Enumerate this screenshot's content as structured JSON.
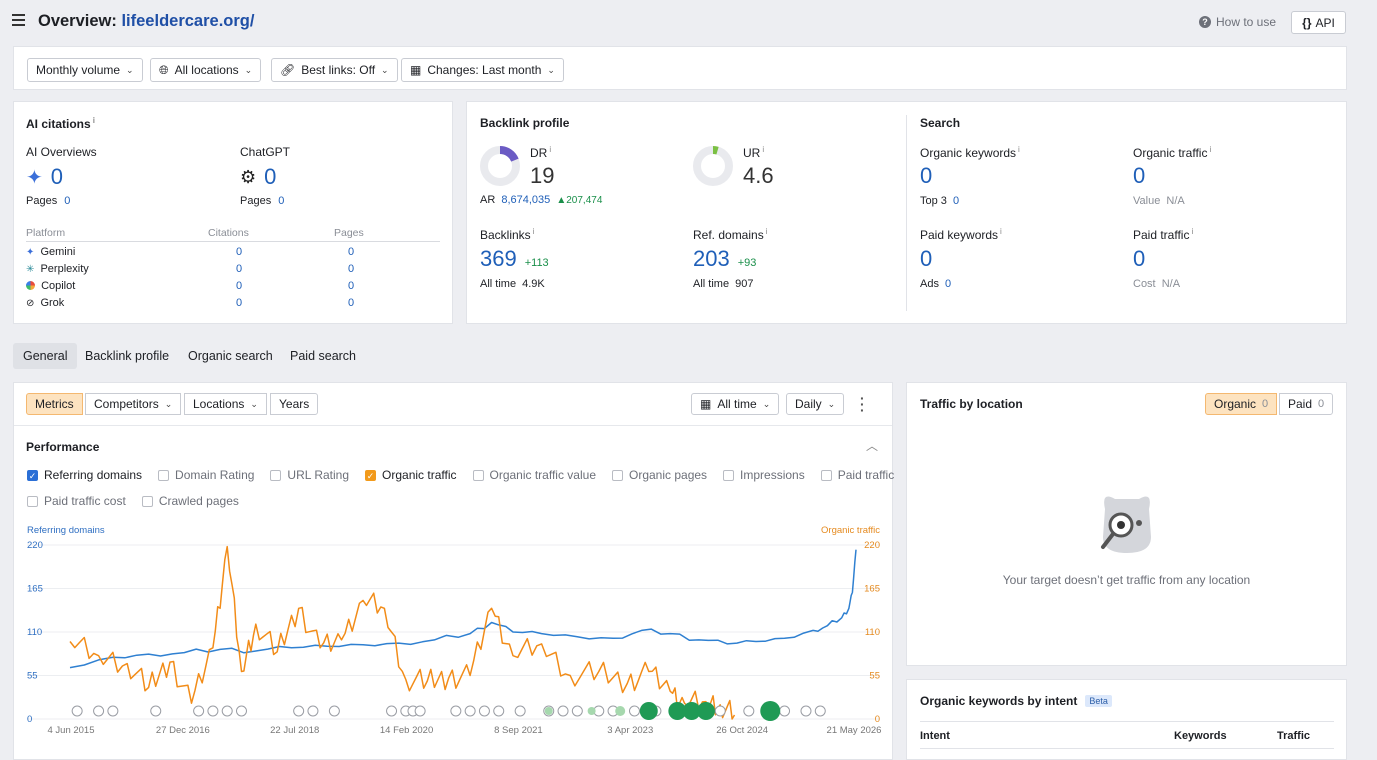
{
  "header": {
    "title_prefix": "Overview:",
    "domain": "lifeeldercare.org/",
    "how_to_use": "How to use",
    "api": "API"
  },
  "filters": {
    "volume": "Monthly volume",
    "locations": "All locations",
    "best_links": "Best links: Off",
    "changes": "Changes: Last month"
  },
  "ai": {
    "title": "AI citations",
    "overviews_label": "AI Overviews",
    "overviews_value": "0",
    "overviews_pages_label": "Pages",
    "overviews_pages_value": "0",
    "chatgpt_label": "ChatGPT",
    "chatgpt_value": "0",
    "chatgpt_pages_label": "Pages",
    "chatgpt_pages_value": "0",
    "table_headers": [
      "Platform",
      "Citations",
      "Pages"
    ],
    "platforms": [
      {
        "name": "Gemini",
        "citations": "0",
        "pages": "0"
      },
      {
        "name": "Perplexity",
        "citations": "0",
        "pages": "0"
      },
      {
        "name": "Copilot",
        "citations": "0",
        "pages": "0"
      },
      {
        "name": "Grok",
        "citations": "0",
        "pages": "0"
      }
    ]
  },
  "backlink": {
    "title": "Backlink profile",
    "dr_label": "DR",
    "dr_value": "19",
    "ur_label": "UR",
    "ur_value": "4.6",
    "ar_label": "AR",
    "ar_value": "8,674,035",
    "ar_change": "▲207,474",
    "backlinks_label": "Backlinks",
    "backlinks_value": "369",
    "backlinks_change": "+113",
    "backlinks_alltime_label": "All time",
    "backlinks_alltime_value": "4.9K",
    "refdomains_label": "Ref. domains",
    "refdomains_value": "203",
    "refdomains_change": "+93",
    "refdomains_alltime_label": "All time",
    "refdomains_alltime_value": "907"
  },
  "search": {
    "title": "Search",
    "organic_keywords_label": "Organic keywords",
    "organic_keywords_value": "0",
    "top3_label": "Top 3",
    "top3_value": "0",
    "organic_traffic_label": "Organic traffic",
    "organic_traffic_value": "0",
    "value_label": "Value",
    "value_value": "N/A",
    "paid_keywords_label": "Paid keywords",
    "paid_keywords_value": "0",
    "ads_label": "Ads",
    "ads_value": "0",
    "paid_traffic_label": "Paid traffic",
    "paid_traffic_value": "0",
    "cost_label": "Cost",
    "cost_value": "N/A"
  },
  "tabs": [
    "General",
    "Backlink profile",
    "Organic search",
    "Paid search"
  ],
  "chart_toolbar": {
    "segments": [
      "Metrics",
      "Competitors",
      "Locations",
      "Years"
    ],
    "range": "All time",
    "granularity": "Daily"
  },
  "performance": {
    "title": "Performance",
    "checkboxes": [
      {
        "label": "Referring domains",
        "checked": true,
        "color": "#2b6fd6"
      },
      {
        "label": "Domain Rating",
        "checked": false
      },
      {
        "label": "URL Rating",
        "checked": false
      },
      {
        "label": "Organic traffic",
        "checked": true,
        "color": "#f29a1b"
      },
      {
        "label": "Organic traffic value",
        "checked": false
      },
      {
        "label": "Organic pages",
        "checked": false
      },
      {
        "label": "Impressions",
        "checked": false
      },
      {
        "label": "Paid traffic",
        "checked": false
      },
      {
        "label": "Paid traffic cost",
        "checked": false
      },
      {
        "label": "Crawled pages",
        "checked": false
      }
    ]
  },
  "chart_data": {
    "type": "line",
    "left_axis_label": "Referring domains",
    "right_axis_label": "Organic traffic",
    "y_ticks_left": [
      "220",
      "165",
      "110",
      "55",
      "0"
    ],
    "y_ticks_right": [
      "220",
      "165",
      "110",
      "55",
      "0"
    ],
    "ylim": [
      0,
      220
    ],
    "x_labels": [
      "4 Jun 2015",
      "27 Dec 2016",
      "22 Jul 2018",
      "14 Feb 2020",
      "8 Sep 2021",
      "3 Apr 2023",
      "26 Oct 2024",
      "21 May 2026"
    ],
    "series": [
      {
        "name": "Referring domains",
        "color": "#2f80d1",
        "x": [
          2015.4,
          2016.0,
          2016.5,
          2017.0,
          2017.5,
          2018.0,
          2018.5,
          2019.0,
          2019.5,
          2020.0,
          2020.5,
          2021.0,
          2021.3,
          2021.6,
          2022.0,
          2022.5,
          2023.0,
          2023.4,
          2023.8,
          2024.2,
          2024.6,
          2025.0,
          2025.4,
          2025.8,
          2026.0,
          2026.2,
          2026.3,
          2026.35,
          2026.4
        ],
        "values": [
          65,
          78,
          82,
          84,
          88,
          86,
          90,
          92,
          94,
          96,
          100,
          108,
          122,
          110,
          108,
          104,
          102,
          112,
          108,
          100,
          95,
          98,
          102,
          112,
          118,
          128,
          140,
          160,
          214
        ]
      },
      {
        "name": "Organic traffic",
        "color": "#f28c18",
        "x": [
          2015.4,
          2015.8,
          2016.2,
          2016.5,
          2016.8,
          2017.1,
          2017.4,
          2017.6,
          2017.8,
          2018.0,
          2018.3,
          2018.6,
          2018.9,
          2019.2,
          2019.5,
          2019.8,
          2020.1,
          2020.4,
          2020.7,
          2021.0,
          2021.3,
          2021.6,
          2022.0,
          2022.4,
          2022.8,
          2023.2,
          2023.5,
          2023.8,
          2024.0,
          2024.3,
          2024.5,
          2024.7
        ],
        "values": [
          98,
          80,
          70,
          40,
          72,
          20,
          90,
          218,
          60,
          120,
          85,
          140,
          90,
          100,
          150,
          140,
          50,
          48,
          52,
          55,
          140,
          80,
          95,
          55,
          60,
          45,
          60,
          35,
          20,
          22,
          18,
          5
        ]
      }
    ],
    "grid": true,
    "legend": "top"
  },
  "traffic_location": {
    "title": "Traffic by location",
    "organic_label": "Organic",
    "organic_count": "0",
    "paid_label": "Paid",
    "paid_count": "0",
    "empty_text": "Your target doesn’t get traffic from any location"
  },
  "intent": {
    "title": "Organic keywords by intent",
    "badge": "Beta",
    "headers": [
      "Intent",
      "Keywords",
      "Traffic"
    ]
  }
}
